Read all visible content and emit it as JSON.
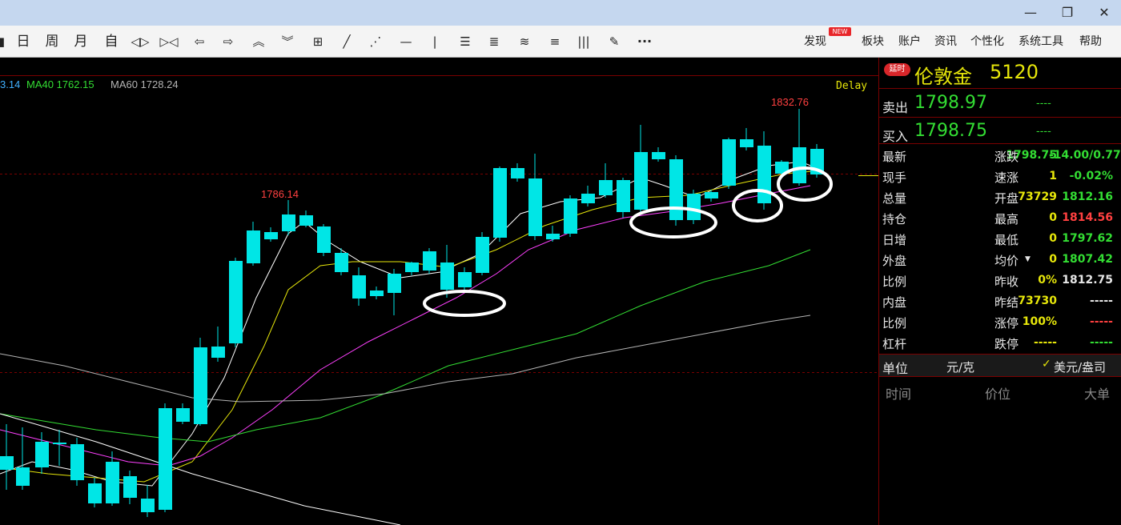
{
  "toolbar": {
    "items": [
      {
        "name": "day-button",
        "label": "日"
      },
      {
        "name": "week-button",
        "label": "周"
      },
      {
        "name": "month-button",
        "label": "月"
      },
      {
        "name": "custom-button",
        "label": "自"
      }
    ],
    "menu": [
      {
        "name": "menu-discover",
        "label": "发现"
      },
      {
        "name": "menu-sector",
        "label": "板块"
      },
      {
        "name": "menu-account",
        "label": "账户"
      },
      {
        "name": "menu-news",
        "label": "资讯"
      },
      {
        "name": "menu-personalize",
        "label": "个性化"
      },
      {
        "name": "menu-system-tools",
        "label": "系统工具"
      },
      {
        "name": "menu-help",
        "label": "帮助"
      }
    ],
    "new_badge": "NEW",
    "more": "···"
  },
  "chart": {
    "ma_labels": [
      {
        "text": "3.14",
        "color": "#40b0ff"
      },
      {
        "text": "MA40 1762.15",
        "color": "#33dd33"
      },
      {
        "text": "MA60 1728.24",
        "color": "#b4b4b4"
      }
    ],
    "delay": "Delay",
    "annotations": [
      {
        "text": "1786.14",
        "color": "#ff4040"
      },
      {
        "text": "1832.76",
        "color": "#ff4040"
      }
    ]
  },
  "quote": {
    "badge": "延时",
    "name": "伦敦金",
    "code": "5120",
    "sell_label": "卖出",
    "sell_price": "1798.97",
    "sell_qty": "----",
    "buy_label": "买入",
    "buy_price": "1798.75",
    "buy_qty": "----",
    "rows": [
      {
        "l1": "最新",
        "v1": "1798.75",
        "c1": "#33dd33",
        "l2": "涨跌",
        "v2": "-14.00/0.77%",
        "c2": "#33dd33"
      },
      {
        "l1": "现手",
        "v1": "1",
        "c1": "#e6e60a",
        "l2": "速涨",
        "v2": "-0.02%",
        "c2": "#33dd33"
      },
      {
        "l1": "总量",
        "v1": "73729",
        "c1": "#e6e60a",
        "l2": "开盘",
        "v2": "1812.16",
        "c2": "#33dd33"
      },
      {
        "l1": "持仓",
        "v1": "0",
        "c1": "#e6e60a",
        "l2": "最高",
        "v2": "1814.56",
        "c2": "#ff4040"
      },
      {
        "l1": "日增",
        "v1": "0",
        "c1": "#e6e60a",
        "l2": "最低",
        "v2": "1797.62",
        "c2": "#33dd33"
      },
      {
        "l1": "外盘",
        "v1": "0",
        "c1": "#e6e60a",
        "l2": "均价",
        "v2": "1807.42",
        "c2": "#33dd33"
      },
      {
        "l1": "比例",
        "v1": "0%",
        "c1": "#e6e60a",
        "l2": "昨收",
        "v2": "1812.75",
        "c2": "#e6e6e6"
      },
      {
        "l1": "内盘",
        "v1": "73730",
        "c1": "#e6e60a",
        "l2": "昨结",
        "v2": "-----",
        "c2": "#e6e6e6"
      },
      {
        "l1": "比例",
        "v1": "100%",
        "c1": "#e6e60a",
        "l2": "涨停",
        "v2": "-----",
        "c2": "#ff4040"
      },
      {
        "l1": "杠杆",
        "v1": "-----",
        "c1": "#e6e60a",
        "l2": "跌停",
        "v2": "-----",
        "c2": "#33dd33"
      }
    ],
    "unit_label": "单位",
    "unit_value": "元/克",
    "currency": "美元/盎司",
    "trade_headers": [
      "时间",
      "价位",
      "大单"
    ]
  },
  "colors": {
    "up": "#ff4040",
    "down": "#00e6e6",
    "ma5": "#ffffff",
    "ma10": "#e6e60a",
    "ma20": "#ff40ff",
    "ma40": "#33dd33",
    "ma60": "#b4b4b4",
    "grid": "#7a0000"
  }
}
